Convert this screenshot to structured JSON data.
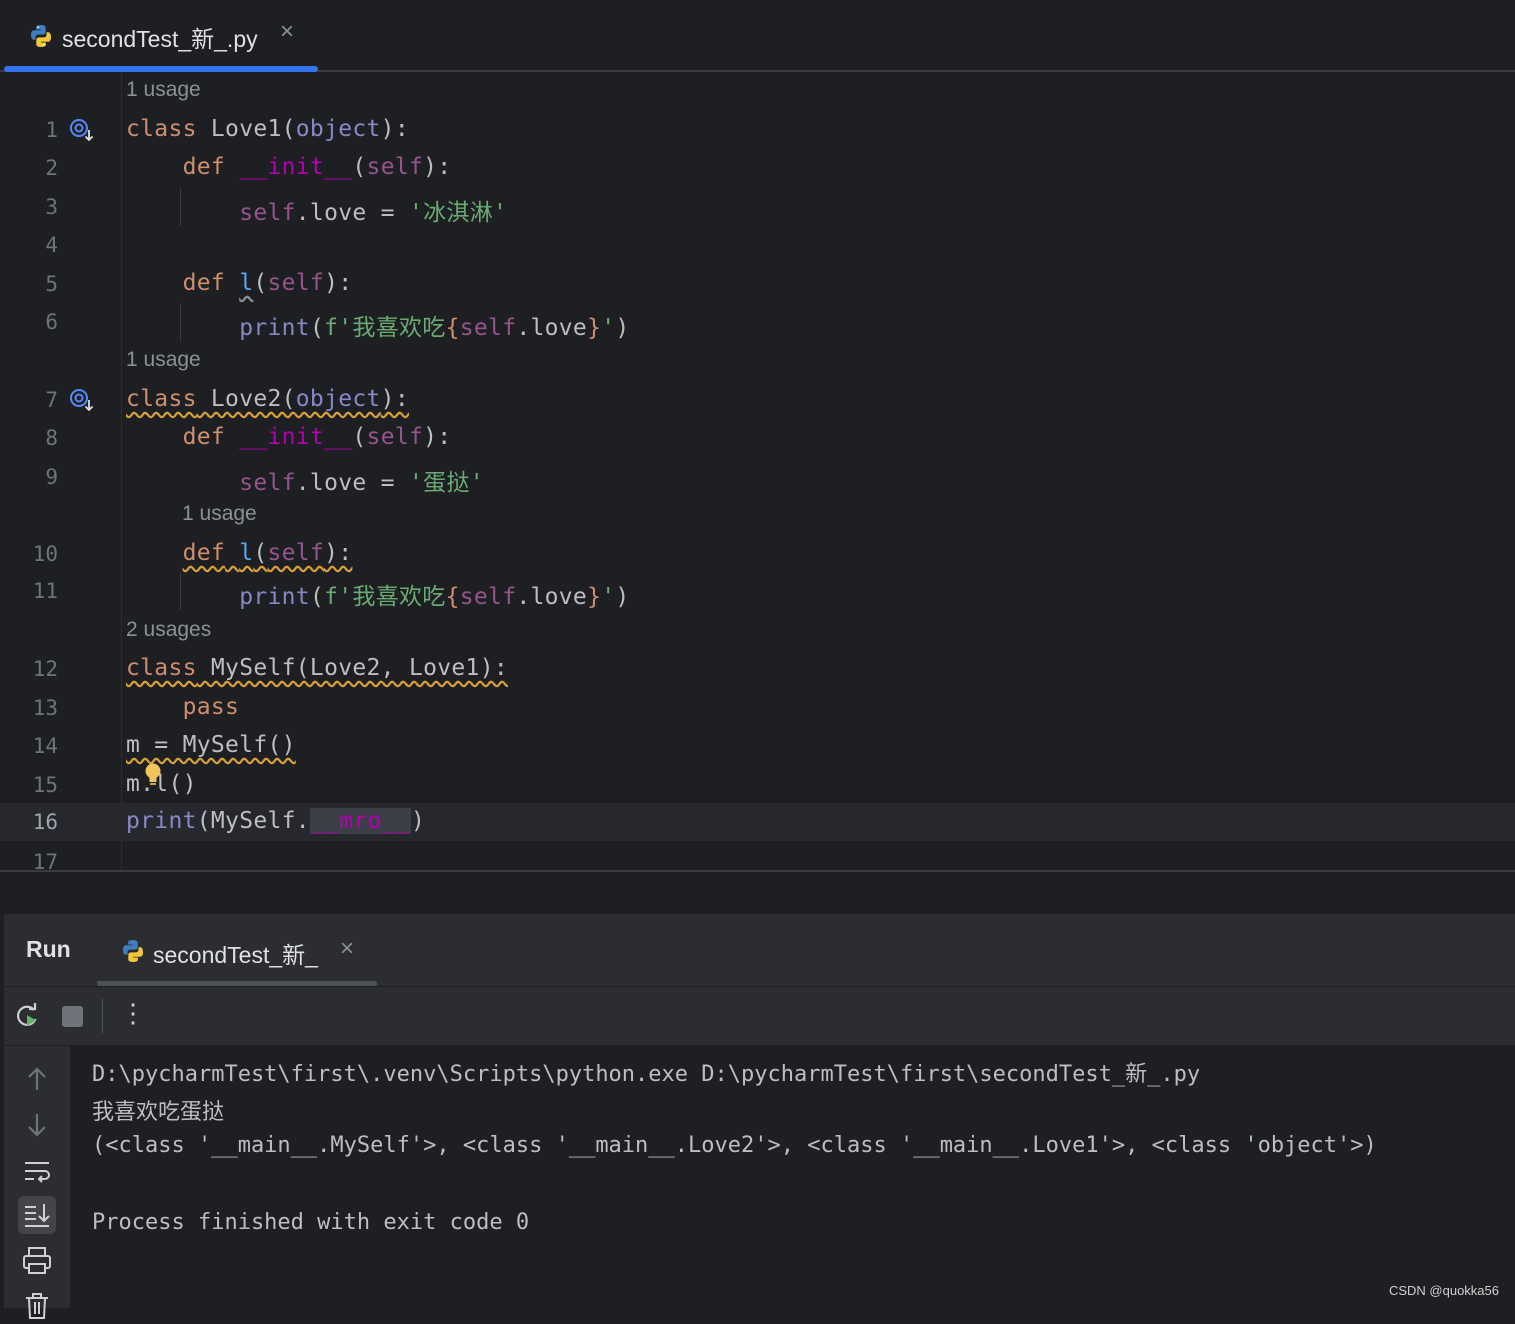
{
  "editor_tab": {
    "label": "secondTest_新_.py",
    "close": "×"
  },
  "inlay_hints": {
    "h1": "1 usage",
    "h2": "1 usage",
    "h3": "1 usage",
    "h4": "2 usages"
  },
  "line_numbers": [
    "1",
    "2",
    "3",
    "4",
    "5",
    "6",
    "7",
    "8",
    "9",
    "10",
    "11",
    "12",
    "13",
    "14",
    "15",
    "16",
    "17"
  ],
  "code": {
    "l1": {
      "kw": "class",
      "name": " Love1(",
      "base": "object",
      "end": "):"
    },
    "l2": {
      "kw": "def",
      "sp": " ",
      "name": "__init__",
      "open": "(",
      "self": "self",
      "end": "):"
    },
    "l3": {
      "self": "self",
      "mid": ".love = ",
      "str": "'冰淇淋'"
    },
    "l5": {
      "kw": "def",
      "sp": " ",
      "name": "l",
      "open": "(",
      "self": "self",
      "end": "):"
    },
    "l6": {
      "fn": "print",
      "open": "(",
      "fstr": "f'我喜欢吃",
      "lb": "{",
      "self": "self",
      "attr": ".love",
      "rb": "}",
      "q": "'",
      "close": ")"
    },
    "l7": {
      "kw": "class",
      "name": " Love2(",
      "base": "object",
      "end": "):"
    },
    "l8": {
      "kw": "def",
      "sp": " ",
      "name": "__init__",
      "open": "(",
      "self": "self",
      "end": "):"
    },
    "l9": {
      "self": "self",
      "mid": ".love = ",
      "str": "'蛋挞'"
    },
    "l10": {
      "kw": "def",
      "sp": " ",
      "name": "l",
      "open": "(",
      "self": "self",
      "end": "):"
    },
    "l11": {
      "fn": "print",
      "open": "(",
      "fstr": "f'我喜欢吃",
      "lb": "{",
      "self": "self",
      "attr": ".love",
      "rb": "}",
      "q": "'",
      "close": ")"
    },
    "l12": {
      "kw": "class",
      "rest": " MySelf(Love2, Love1):"
    },
    "l13": {
      "kw": "pass"
    },
    "l14": {
      "text": "m = MySelf()"
    },
    "l15": {
      "text": "m.l()"
    },
    "l16": {
      "fn": "print",
      "mid": "(MySelf.",
      "mro": "__mro__",
      "close": ")"
    }
  },
  "run_panel": {
    "title": "Run",
    "tab_label": "secondTest_新_",
    "close": "×",
    "more": "⋮"
  },
  "console": {
    "line1": "D:\\pycharmTest\\first\\.venv\\Scripts\\python.exe D:\\pycharmTest\\first\\secondTest_新_.py",
    "line2": "我喜欢吃蛋挞",
    "line3": "(<class '__main__.MySelf'>, <class '__main__.Love2'>, <class '__main__.Love1'>, <class 'object'>)",
    "line4": "Process finished with exit code 0"
  },
  "watermark": "CSDN @quokka56",
  "icons": {
    "tab": "python-file-icon",
    "gutter": "overridden-method-icon",
    "bulb": "lightbulb-icon",
    "toolbar": [
      "rerun-icon",
      "stop-icon",
      "more-icon"
    ],
    "side": [
      "arrow-up-icon",
      "arrow-down-icon",
      "soft-wrap-icon",
      "scroll-to-end-icon",
      "print-icon",
      "trash-icon"
    ]
  },
  "colors": {
    "keyword": "#cf8e6d",
    "function": "#56a8f5",
    "magic": "#b200b2",
    "self": "#94558d",
    "builtin": "#8888c6",
    "string": "#6aab73",
    "accent": "#3574f0"
  }
}
